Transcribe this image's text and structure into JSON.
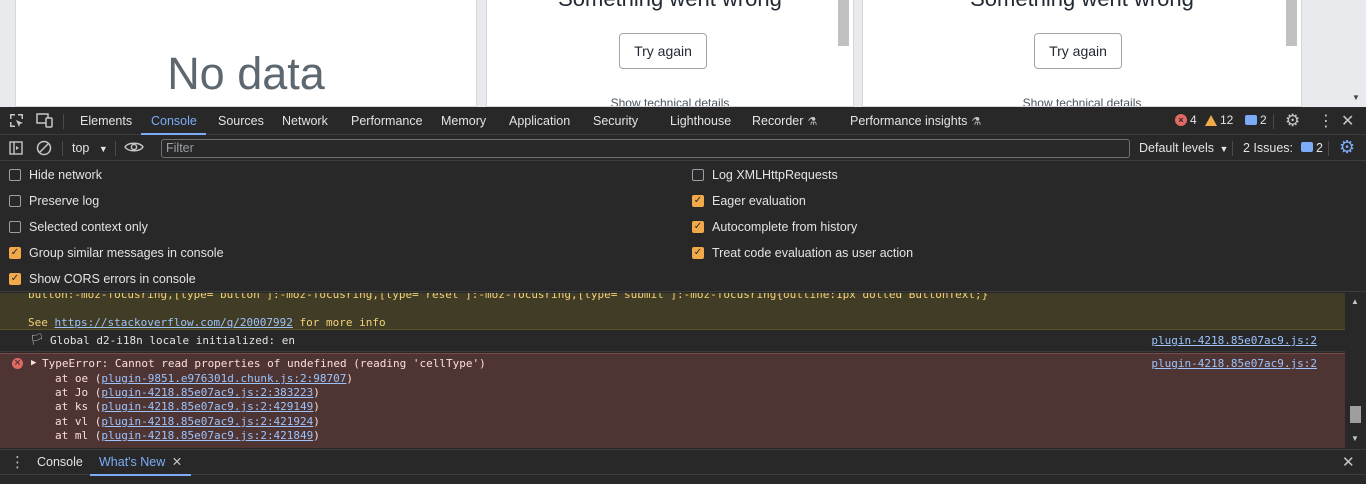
{
  "page": {
    "left_panel": {
      "message": "No data"
    },
    "middle_panel": {
      "title": "Something went wrong",
      "button": "Try again",
      "details": "Show technical details"
    },
    "right_panel": {
      "title": "Something went wrong",
      "button": "Try again",
      "details": "Show technical details"
    }
  },
  "devtools": {
    "tabs": [
      "Elements",
      "Console",
      "Sources",
      "Network",
      "Performance",
      "Memory",
      "Application",
      "Security",
      "Lighthouse",
      "Recorder",
      "Performance insights"
    ],
    "active_tab": "Console",
    "counts": {
      "errors": "4",
      "warnings": "12",
      "messages": "2"
    },
    "filterbar": {
      "context": "top",
      "filter_placeholder": "Filter",
      "levels": "Default levels",
      "issues_label": "2 Issues:",
      "issues_count": "2"
    },
    "settings": {
      "left": [
        {
          "label": "Hide network",
          "checked": false
        },
        {
          "label": "Preserve log",
          "checked": false
        },
        {
          "label": "Selected context only",
          "checked": false
        },
        {
          "label": "Group similar messages in console",
          "checked": true
        },
        {
          "label": "Show CORS errors in console",
          "checked": true
        }
      ],
      "right": [
        {
          "label": "Log XMLHttpRequests",
          "checked": false
        },
        {
          "label": "Eager evaluation",
          "checked": true
        },
        {
          "label": "Autocomplete from history",
          "checked": true
        },
        {
          "label": "Treat code evaluation as user action",
          "checked": true
        }
      ]
    },
    "console": {
      "warning_line": "button:-moz-focusring,[type=\"button\"]:-moz-focusring,[type=\"reset\"]:-moz-focusring,[type=\"submit\"]:-moz-focusring{outline:1px dotted ButtonText;}",
      "see_prefix": "See ",
      "see_link": "https://stackoverflow.com/q/20007992",
      "see_suffix": " for more info",
      "info_text": "Global d2-i18n locale initialized: en",
      "info_source": "plugin-4218.85e07ac9.js:2",
      "error_text": "TypeError: Cannot read properties of undefined (reading 'cellType')",
      "error_source": "plugin-4218.85e07ac9.js:2",
      "stack": [
        {
          "fn": "at oe",
          "loc": "plugin-9851.e976301d.chunk.js:2:98707"
        },
        {
          "fn": "at Jo",
          "loc": "plugin-4218.85e07ac9.js:2:383223"
        },
        {
          "fn": "at ks",
          "loc": "plugin-4218.85e07ac9.js:2:429149"
        },
        {
          "fn": "at vl",
          "loc": "plugin-4218.85e07ac9.js:2:421924"
        },
        {
          "fn": "at ml",
          "loc": "plugin-4218.85e07ac9.js:2:421849"
        }
      ]
    },
    "drawer": {
      "tabs": [
        "Console",
        "What's New"
      ],
      "active": "What's New"
    }
  }
}
